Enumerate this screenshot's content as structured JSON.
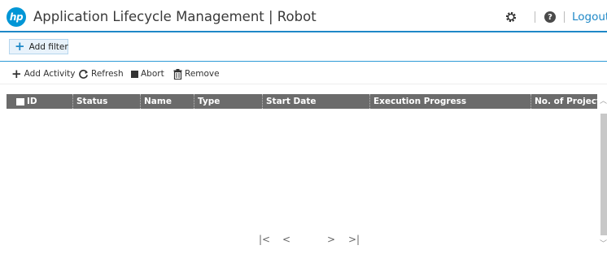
{
  "header": {
    "logo_text": "hp",
    "title": "Application Lifecycle Management | Robot",
    "settings_icon": "gear-icon",
    "help_icon": "question-circle-icon",
    "help_glyph": "?",
    "logout_label": "Logout"
  },
  "filter_bar": {
    "add_filter_icon": "plus-icon",
    "add_filter_label": "Add filter"
  },
  "toolbar": {
    "add_activity_label": "Add Activity",
    "refresh_label": "Refresh",
    "abort_label": "Abort",
    "remove_label": "Remove"
  },
  "grid": {
    "columns": [
      "ID",
      "Status",
      "Name",
      "Type",
      "Start Date",
      "Execution Progress",
      "No. of Projects"
    ],
    "rows": []
  },
  "pager": {
    "first": "|<",
    "prev": "<",
    "next": ">",
    "last": ">|"
  },
  "colors": {
    "accent": "#1e88c7",
    "grid_header": "#6b6b6b",
    "filter_button_bg": "#e8f2fb"
  }
}
